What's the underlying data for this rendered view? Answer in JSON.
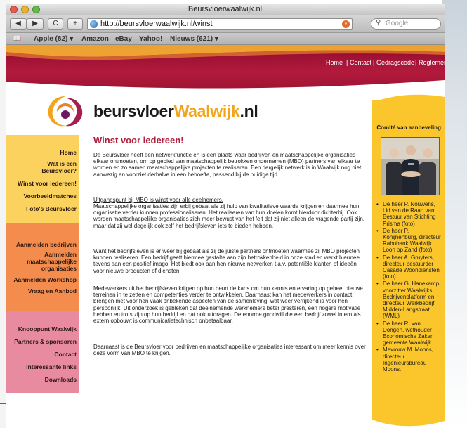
{
  "window": {
    "title": "Beursvloerwaalwijk.nl"
  },
  "toolbar": {
    "back_label": "◀",
    "forward_label": "▶",
    "reload_label": "C",
    "add_label": "+",
    "url": "http://beursvloerwaalwijk.nl/winst",
    "search_placeholder": "Google"
  },
  "bookmarks": [
    "Apple (82) ▾",
    "Amazon",
    "eBay",
    "Yahoo!",
    "Nieuws (621) ▾"
  ],
  "header": {
    "links": [
      "Home",
      "Contact",
      "Gedragscode",
      "Reglement"
    ],
    "separator": "|"
  },
  "logo": {
    "prefix": "beursvloer",
    "accent": "Waalwijk",
    "suffix": ".nl"
  },
  "colors": {
    "header": "#a3142f",
    "nav_yellow": "#fcd25f",
    "nav_orange": "#f38c4d",
    "nav_pink": "#e88aa0",
    "right_column": "#fbc62c",
    "title": "#b0203d",
    "logo_accent": "#f2a51c"
  },
  "nav": {
    "yellow": [
      "Home",
      "Wat is een\nBeursvloer?",
      "Winst voor iedereen!",
      "Voorbeeldmatches",
      "Foto's Beursvloer"
    ],
    "orange": [
      "Aanmelden bedrijven",
      "Aanmelden\nmaatschappelijke\norganisaties",
      "Aanmelden Workshop",
      "Vraag en Aanbod"
    ],
    "pink": [
      "Knooppunt Waalwijk",
      "Partners & sponsoren",
      "Contact",
      "Interessante links",
      "Downloads"
    ]
  },
  "main": {
    "title": "Winst voor iedereen!",
    "paragraphs": [
      "De Beursvloer heeft een netwerkfunctie en is een plaats waar bedrijven en maatschappelijke organisaties elkaar ontmoeten, om op gebied van maatschappelijk betrokken ondernemen (MBO) partners van elkaar te worden en zo samen maatschappelijke projecten te realiseren. Een dergelijk netwerk is in Waalwijk nog niet aanwezig en voorziet derhalve in een behoefte, passend bij de huidige tijd.",
      "Maatschappelijke organisaties zijn erbij gebaat als zij hulp van kwalitatieve waarde krijgen en daarmee hun organisatie verder kunnen professionaliseren. Het realiseren van hun doelen komt hierdoor dichterbij. Ook worden maatschappelijke organisaties zich meer bewust van het feit dat zij niet alleen de vragende partij zijn, maar dat zij wel degelijk ook zelf het bedrijfsleven iets te bieden hebben.",
      "Want het bedrijfsleven is er weer bij gebaat als zij de juiste partners ontmoeten waarmee zij MBO projecten kunnen realiseren. Een bedrijf geeft hiermee gestalte aan zijn betrokkenheid in onze stad en werkt hiermee tevens aan een positief imago. Het biedt ook aan hen nieuwe netwerken t.a.v. potentiële klanten of ideeën voor nieuwe producten of diensten.",
      "Medewerkers uit het bedrijfsleven krijgen op hun beurt de kans om hun kennis en ervaring op geheel nieuwe terreinen in te zetten en competenties verder te ontwikkelen. Daarnaast kan het medewerkers in contact brengen met voor hen vaak onbekende aspecten van de samenleving, wat weer verrijkend is voor hen persoonlijk. Uit onderzoek is gebleken dat deelnemende werknemers beter presteren, een hogere motivatie hebben en trots zijn op hun bedrijf en dat ook uitdragen. De enorme goodwill die een bedrijf zowel intern als extern opbouwt is communicatietechnisch onbetaalbaar.",
      "Daarnaast is de Beursvloer voor bedrijven en maatschappelijke organisaties interessant om meer kennis over deze vorm van MBO te krijgen."
    ],
    "subheading": "Uitgangspunt bij MBO is winst voor alle deelnemers."
  },
  "right": {
    "title": "Comité van aanbeveling:",
    "bullet": "•",
    "items": [
      "De heer P. Nouwens, Lid van de Raad van Bestuur van Stichting Prisma (foto)",
      "De heer P. Konijnenburg, directeur Rabobank Waalwijk Loon op Zand (foto)",
      "De heer A. Gruyters, directeur-bestuurder Casade Woondiensten (foto)",
      "De heer G. Hanekamp, voorzitter Waalwijks Bedrijvenplatform en directeur Werkbedrijf Midden-Langstraat (WML)",
      "De heer R. van Dongen, wethouder Economische Zaken gemeente Waalwijk",
      "Mevrouw M. Moons, directeur Ingenieursbureau Moons."
    ]
  }
}
